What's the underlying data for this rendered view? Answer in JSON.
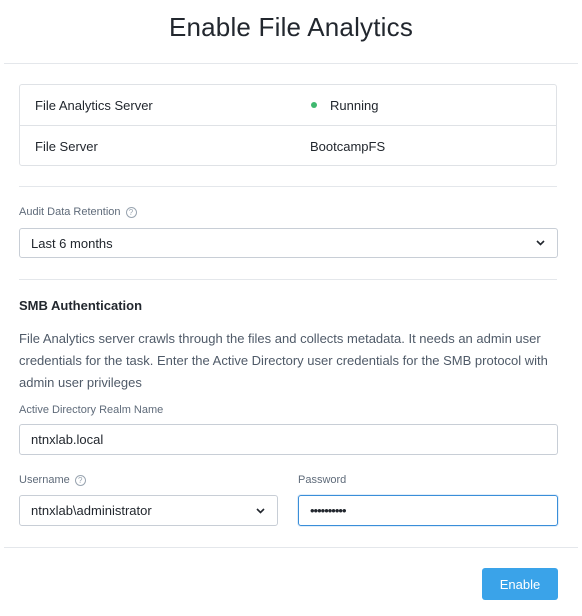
{
  "dialog": {
    "title": "Enable File Analytics"
  },
  "info": {
    "rows": [
      {
        "key": "File Analytics Server",
        "value": "Running",
        "status_color": "#3fb86f"
      },
      {
        "key": "File Server",
        "value": "BootcampFS"
      }
    ]
  },
  "retention": {
    "label": "Audit Data Retention",
    "help_icon": "question-circle-icon",
    "selected": "Last 6 months"
  },
  "smb": {
    "section_title": "SMB Authentication",
    "description": "File Analytics server crawls through the files and collects metadata. It needs an admin user credentials for the task. Enter the Active Directory user credentials for the SMB protocol with admin user privileges",
    "realm_label": "Active Directory Realm Name",
    "realm_value": "ntnxlab.local",
    "username_label": "Username",
    "username_value": "ntnxlab\\administrator",
    "password_label": "Password",
    "password_value": "••••••••••"
  },
  "footer": {
    "enable_label": "Enable"
  },
  "colors": {
    "primary": "#3aa3e9",
    "focus_border": "#3a8ed9",
    "status_running": "#3fb86f"
  }
}
